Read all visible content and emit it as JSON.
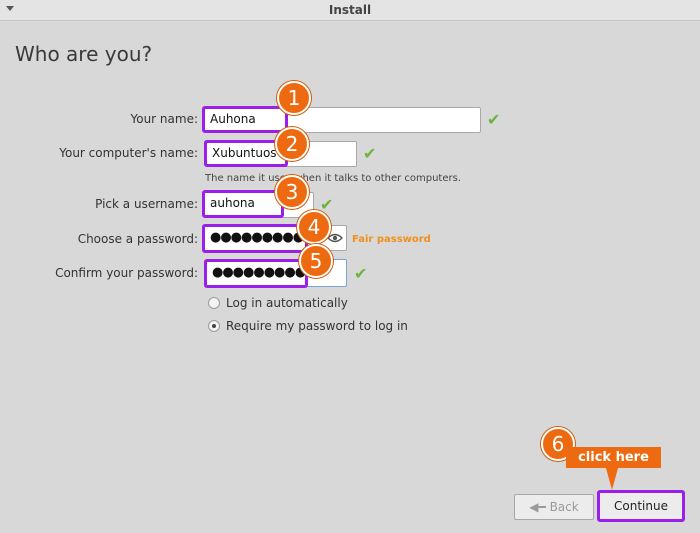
{
  "window": {
    "title": "Install"
  },
  "page": {
    "heading": "Who are you?"
  },
  "form": {
    "name": {
      "label": "Your name:",
      "value": "Auhona"
    },
    "computer": {
      "label": "Your computer's name:",
      "value": "Xubuntuos",
      "hint": "The name it uses when it talks to other computers."
    },
    "username": {
      "label": "Pick a username:",
      "value": "auhona"
    },
    "password": {
      "label": "Choose a password:",
      "value": "●●●●●●●●●●",
      "strength": "Fair password"
    },
    "confirm": {
      "label": "Confirm your password:",
      "value": "●●●●●●●●●●"
    },
    "login_options": [
      {
        "label": "Log in automatically",
        "selected": false
      },
      {
        "label": "Require my password to log in",
        "selected": true
      }
    ]
  },
  "badges": [
    "1",
    "2",
    "3",
    "4",
    "5",
    "6"
  ],
  "callout": "click here",
  "buttons": {
    "back": "Back",
    "continue": "Continue"
  },
  "colors": {
    "highlight": "#9b1fe8",
    "badge": "#ee6a10",
    "check": "#6cb33f",
    "strength": "#f0901a"
  },
  "icons": {
    "valid": "check-icon",
    "reveal": "eye-icon",
    "back": "arrow-left-icon"
  }
}
